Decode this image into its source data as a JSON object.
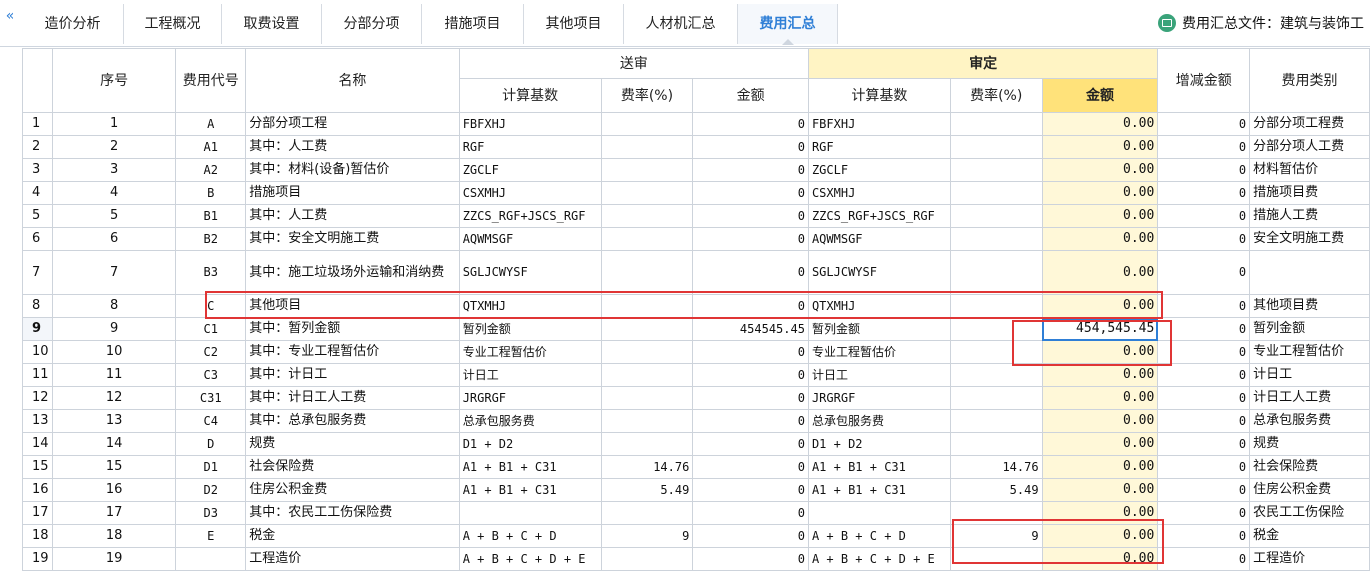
{
  "tabs": [
    {
      "label": "造价分析",
      "active": false
    },
    {
      "label": "工程概况",
      "active": false
    },
    {
      "label": "取费设置",
      "active": false
    },
    {
      "label": "分部分项",
      "active": false
    },
    {
      "label": "措施项目",
      "active": false
    },
    {
      "label": "其他项目",
      "active": false
    },
    {
      "label": "人材机汇总",
      "active": false
    },
    {
      "label": "费用汇总",
      "active": true
    }
  ],
  "summary_file": {
    "label": "费用汇总文件：建筑与装饰工"
  },
  "icons": {
    "collapse": "double-chevron-left-icon",
    "file": "book-icon"
  },
  "header": {
    "seq": "序号",
    "code": "费用代号",
    "name": "名称",
    "submitted": "送审",
    "review": "审定",
    "calc_base": "计算基数",
    "rate": "费率(%)",
    "amount": "金额",
    "change": "增减金额",
    "category": "费用类别"
  },
  "colors": {
    "accent": "#2f7fd6",
    "review_header": "#fff4c4",
    "amount_header": "#ffe27a",
    "highlight": "#e03535"
  },
  "rows": [
    {
      "n": "1",
      "seq": "1",
      "code": "A",
      "name": "分部分项工程",
      "s_base": "FBFXHJ",
      "s_rate": "",
      "s_amt": "0",
      "r_base": "FBFXHJ",
      "r_rate": "",
      "r_amt": "0.00",
      "change": "0",
      "category": "分部分项工程费"
    },
    {
      "n": "2",
      "seq": "2",
      "code": "A1",
      "name": "其中：人工费",
      "s_base": "RGF",
      "s_rate": "",
      "s_amt": "0",
      "r_base": "RGF",
      "r_rate": "",
      "r_amt": "0.00",
      "change": "0",
      "category": "分部分项人工费"
    },
    {
      "n": "3",
      "seq": "3",
      "code": "A2",
      "name": "其中：材料(设备)暂估价",
      "s_base": "ZGCLF",
      "s_rate": "",
      "s_amt": "0",
      "r_base": "ZGCLF",
      "r_rate": "",
      "r_amt": "0.00",
      "change": "0",
      "category": "材料暂估价"
    },
    {
      "n": "4",
      "seq": "4",
      "code": "B",
      "name": "措施项目",
      "s_base": "CSXMHJ",
      "s_rate": "",
      "s_amt": "0",
      "r_base": "CSXMHJ",
      "r_rate": "",
      "r_amt": "0.00",
      "change": "0",
      "category": "措施项目费"
    },
    {
      "n": "5",
      "seq": "5",
      "code": "B1",
      "name": "其中：人工费",
      "s_base": "ZZCS_RGF+JSCS_RGF",
      "s_rate": "",
      "s_amt": "0",
      "r_base": "ZZCS_RGF+JSCS_RGF",
      "r_rate": "",
      "r_amt": "0.00",
      "change": "0",
      "category": "措施人工费"
    },
    {
      "n": "6",
      "seq": "6",
      "code": "B2",
      "name": "其中：安全文明施工费",
      "s_base": "AQWMSGF",
      "s_rate": "",
      "s_amt": "0",
      "r_base": "AQWMSGF",
      "r_rate": "",
      "r_amt": "0.00",
      "change": "0",
      "category": "安全文明施工费"
    },
    {
      "n": "7",
      "seq": "7",
      "code": "B3",
      "name": "其中：施工垃圾场外运输和消纳费",
      "s_base": "SGLJCWYSF",
      "s_rate": "",
      "s_amt": "0",
      "r_base": "SGLJCWYSF",
      "r_rate": "",
      "r_amt": "0.00",
      "change": "0",
      "category": ""
    },
    {
      "n": "8",
      "seq": "8",
      "code": "C",
      "name": "其他项目",
      "s_base": "QTXMHJ",
      "s_rate": "",
      "s_amt": "0",
      "r_base": "QTXMHJ",
      "r_rate": "",
      "r_amt": "0.00",
      "change": "0",
      "category": "其他项目费"
    },
    {
      "n": "9",
      "seq": "9",
      "code": "C1",
      "name": "其中：暂列金额",
      "s_base": "暂列金额",
      "s_rate": "",
      "s_amt": "454545.45",
      "r_base": "暂列金额",
      "r_rate": "",
      "r_amt": "454,545.45",
      "change": "0",
      "category": "暂列金额"
    },
    {
      "n": "10",
      "seq": "10",
      "code": "C2",
      "name": "其中：专业工程暂估价",
      "s_base": "专业工程暂估价",
      "s_rate": "",
      "s_amt": "0",
      "r_base": "专业工程暂估价",
      "r_rate": "",
      "r_amt": "0.00",
      "change": "0",
      "category": "专业工程暂估价"
    },
    {
      "n": "11",
      "seq": "11",
      "code": "C3",
      "name": "其中：计日工",
      "s_base": "计日工",
      "s_rate": "",
      "s_amt": "0",
      "r_base": "计日工",
      "r_rate": "",
      "r_amt": "0.00",
      "change": "0",
      "category": "计日工"
    },
    {
      "n": "12",
      "seq": "12",
      "code": "C31",
      "name": "其中：计日工人工费",
      "s_base": "JRGRGF",
      "s_rate": "",
      "s_amt": "0",
      "r_base": "JRGRGF",
      "r_rate": "",
      "r_amt": "0.00",
      "change": "0",
      "category": "计日工人工费"
    },
    {
      "n": "13",
      "seq": "13",
      "code": "C4",
      "name": "其中：总承包服务费",
      "s_base": "总承包服务费",
      "s_rate": "",
      "s_amt": "0",
      "r_base": "总承包服务费",
      "r_rate": "",
      "r_amt": "0.00",
      "change": "0",
      "category": "总承包服务费"
    },
    {
      "n": "14",
      "seq": "14",
      "code": "D",
      "name": "规费",
      "s_base": "D1 + D2",
      "s_rate": "",
      "s_amt": "0",
      "r_base": "D1 + D2",
      "r_rate": "",
      "r_amt": "0.00",
      "change": "0",
      "category": "规费"
    },
    {
      "n": "15",
      "seq": "15",
      "code": "D1",
      "name": "社会保险费",
      "s_base": "A1 + B1 + C31",
      "s_rate": "14.76",
      "s_amt": "0",
      "r_base": "A1 + B1 + C31",
      "r_rate": "14.76",
      "r_amt": "0.00",
      "change": "0",
      "category": "社会保险费"
    },
    {
      "n": "16",
      "seq": "16",
      "code": "D2",
      "name": "住房公积金费",
      "s_base": "A1 + B1 + C31",
      "s_rate": "5.49",
      "s_amt": "0",
      "r_base": "A1 + B1 + C31",
      "r_rate": "5.49",
      "r_amt": "0.00",
      "change": "0",
      "category": "住房公积金费"
    },
    {
      "n": "17",
      "seq": "17",
      "code": "D3",
      "name": "其中：农民工工伤保险费",
      "s_base": "",
      "s_rate": "",
      "s_amt": "0",
      "r_base": "",
      "r_rate": "",
      "r_amt": "0.00",
      "change": "0",
      "category": "农民工工伤保险"
    },
    {
      "n": "18",
      "seq": "18",
      "code": "E",
      "name": "税金",
      "s_base": "A + B + C + D",
      "s_rate": "9",
      "s_amt": "0",
      "r_base": "A + B + C + D",
      "r_rate": "9",
      "r_amt": "0.00",
      "change": "0",
      "category": "税金"
    },
    {
      "n": "19",
      "seq": "19",
      "code": "",
      "name": "工程造价",
      "s_base": "A + B + C + D + E",
      "s_rate": "",
      "s_amt": "0",
      "r_base": "A + B + C + D + E",
      "r_rate": "",
      "r_amt": "0.00",
      "change": "0",
      "category": "工程造价"
    }
  ]
}
